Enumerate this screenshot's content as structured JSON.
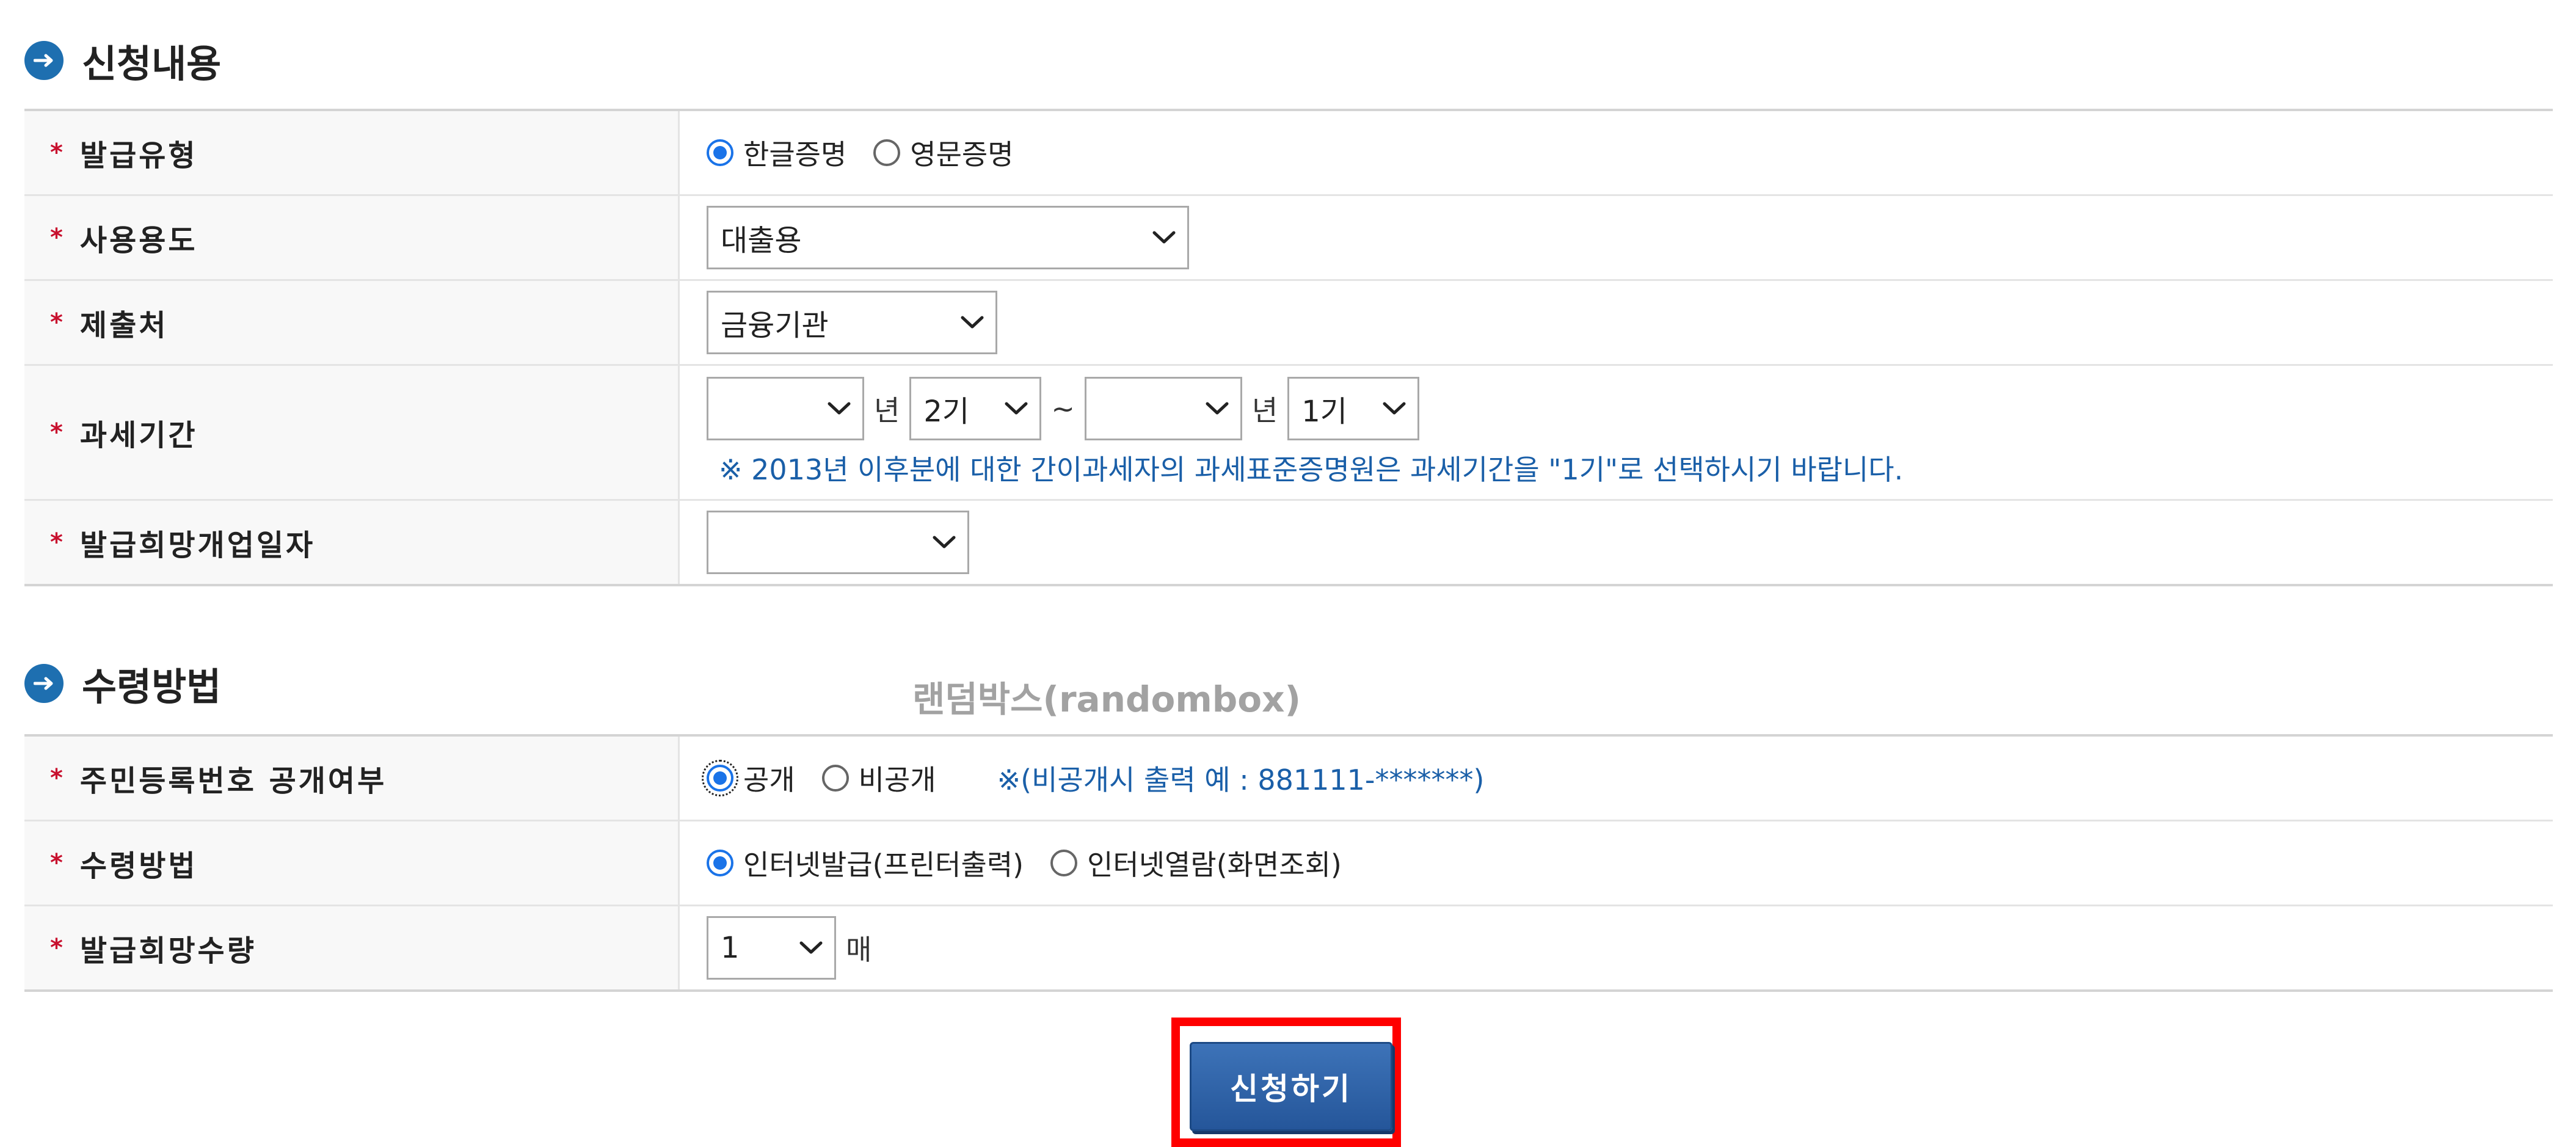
{
  "section1": {
    "title": "신청내용",
    "rows": {
      "issue_type": {
        "label": "발급유형",
        "options": [
          "한글증명",
          "영문증명"
        ]
      },
      "purpose": {
        "label": "사용용도",
        "value": "대출용"
      },
      "submit_to": {
        "label": "제출처",
        "value": "금융기관"
      },
      "tax_period": {
        "label": "과세기간",
        "start_year": "",
        "start_term": "2기",
        "tilde": "~",
        "end_year": "",
        "end_term": "1기",
        "year_unit": "년",
        "note": "※ 2013년 이후분에 대한 간이과세자의 과세표준증명원은 과세기간을 \"1기\"로 선택하시기 바랍니다."
      },
      "open_date": {
        "label": "발급희망개업일자",
        "value": ""
      }
    }
  },
  "section2": {
    "title": "수령방법",
    "watermark": "랜덤박스(randombox)",
    "rows": {
      "id_disclosure": {
        "label": "주민등록번호 공개여부",
        "options": [
          "공개",
          "비공개"
        ],
        "note": "※(비공개시 출력 예 : 881111-*******)"
      },
      "receive_method": {
        "label": "수령방법",
        "options": [
          "인터넷발급(프린터출력)",
          "인터넷열람(화면조회)"
        ]
      },
      "quantity": {
        "label": "발급희망수량",
        "value": "1",
        "unit": "매"
      }
    }
  },
  "submit_label": "신청하기",
  "colors": {
    "accent": "#1a73e8",
    "section_bullet": "#1e6fb0",
    "required_star": "#c8102e",
    "note_text": "#1a5fa8",
    "submit_button": "#2f63a8",
    "highlight_frame": "#ff0000"
  }
}
